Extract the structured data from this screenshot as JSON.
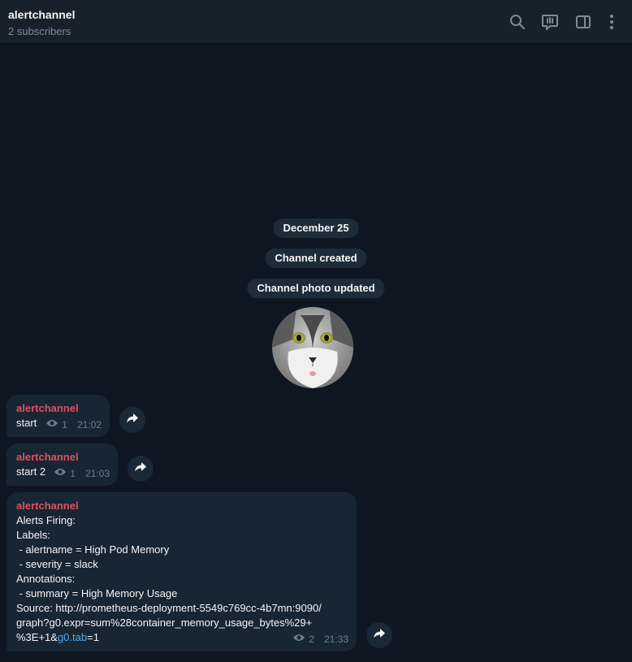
{
  "header": {
    "title": "alertchannel",
    "subtitle": "2 subscribers",
    "icons": [
      "search-icon",
      "live-stream-icon",
      "sidebar-toggle-icon",
      "more-vert-icon"
    ]
  },
  "service": {
    "date": "December 25",
    "created": "Channel created",
    "photo_updated": "Channel photo updated"
  },
  "messages": [
    {
      "sender": "alertchannel",
      "text": "start",
      "views": "1",
      "time": "21:02"
    },
    {
      "sender": "alertchannel",
      "text": "start 2",
      "views": "1",
      "time": "21:03"
    },
    {
      "sender": "alertchannel",
      "lines": [
        "Alerts Firing:",
        "Labels:",
        " - alertname = High Pod Memory",
        " - severity = slack",
        "Annotations:",
        " - summary = High Memory Usage",
        "Source: http://prometheus-deployment-5549c769cc-4b7mn:9090/",
        "graph?g0.expr=sum%28container_memory_usage_bytes%29+"
      ],
      "last_line_prefix": "%3E+1&",
      "last_line_link": "g0.tab",
      "last_line_suffix": "=1",
      "views": "2",
      "time": "21:33"
    }
  ],
  "colors": {
    "background": "#0e1621",
    "header": "#17212b",
    "bubble": "#182533",
    "sender": "#e0505c",
    "link": "#5aa8e6",
    "meta": "#6d7f8f"
  }
}
